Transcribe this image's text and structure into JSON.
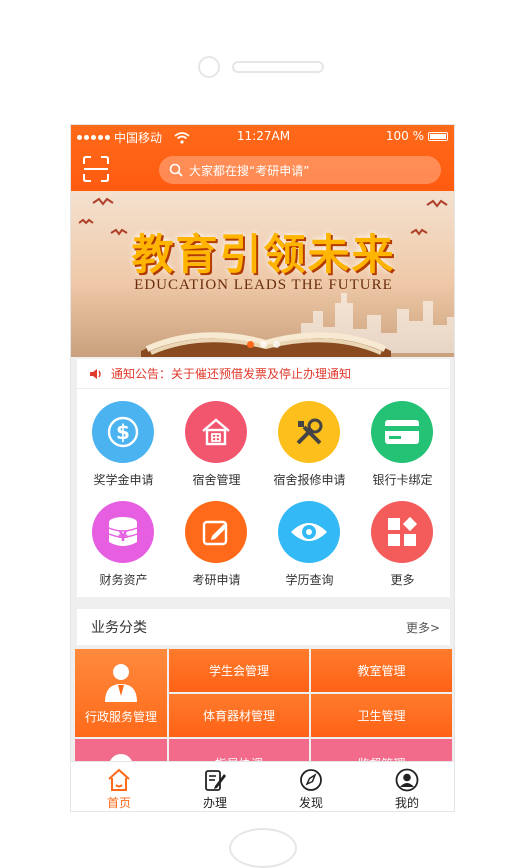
{
  "status_bar": {
    "carrier": "中国移动",
    "time": "11:27AM",
    "battery": "100 %"
  },
  "search": {
    "placeholder": "大家都在搜“考研申请”"
  },
  "banner": {
    "title": "教育引领未来",
    "subtitle": "EDUCATION LEADS THE FUTURE",
    "active_slide": 1,
    "slides": 3
  },
  "notice": {
    "text": "通知公告：关于催还预借发票及停止办理通知"
  },
  "services": [
    {
      "label": "奖学金申请",
      "icon": "dollar-icon",
      "color": "#4ab3f0"
    },
    {
      "label": "宿舍管理",
      "icon": "house-icon",
      "color": "#f2556e"
    },
    {
      "label": "宿舍报修申请",
      "icon": "tools-icon",
      "color": "#fdbf1c"
    },
    {
      "label": "银行卡绑定",
      "icon": "bank-card-icon",
      "color": "#23c274"
    },
    {
      "label": "财务资产",
      "icon": "yuan-coins-icon",
      "color": "#e55fe0"
    },
    {
      "label": "考研申请",
      "icon": "pencil-note-icon",
      "color": "#ff6a1a"
    },
    {
      "label": "学历查询",
      "icon": "eye-icon",
      "color": "#33b9f6"
    },
    {
      "label": "更多",
      "icon": "more-grid-icon",
      "color": "#f45b5b"
    }
  ],
  "business": {
    "title": "业务分类",
    "more": "更多>",
    "admin_label": "行政服务管理",
    "tiles": [
      "学生会管理",
      "教室管理",
      "体育器材管理",
      "卫生管理",
      "指导协调",
      "监督管理"
    ]
  },
  "tabbar": [
    {
      "label": "首页",
      "icon": "home-icon",
      "active": true
    },
    {
      "label": "办理",
      "icon": "clipboard-pen-icon",
      "active": false
    },
    {
      "label": "发现",
      "icon": "compass-icon",
      "active": false
    },
    {
      "label": "我的",
      "icon": "user-icon",
      "active": false
    }
  ],
  "colors": {
    "accent": "#ff6a1a",
    "notice_red": "#e03a2c",
    "pink": "#f26b8a"
  }
}
